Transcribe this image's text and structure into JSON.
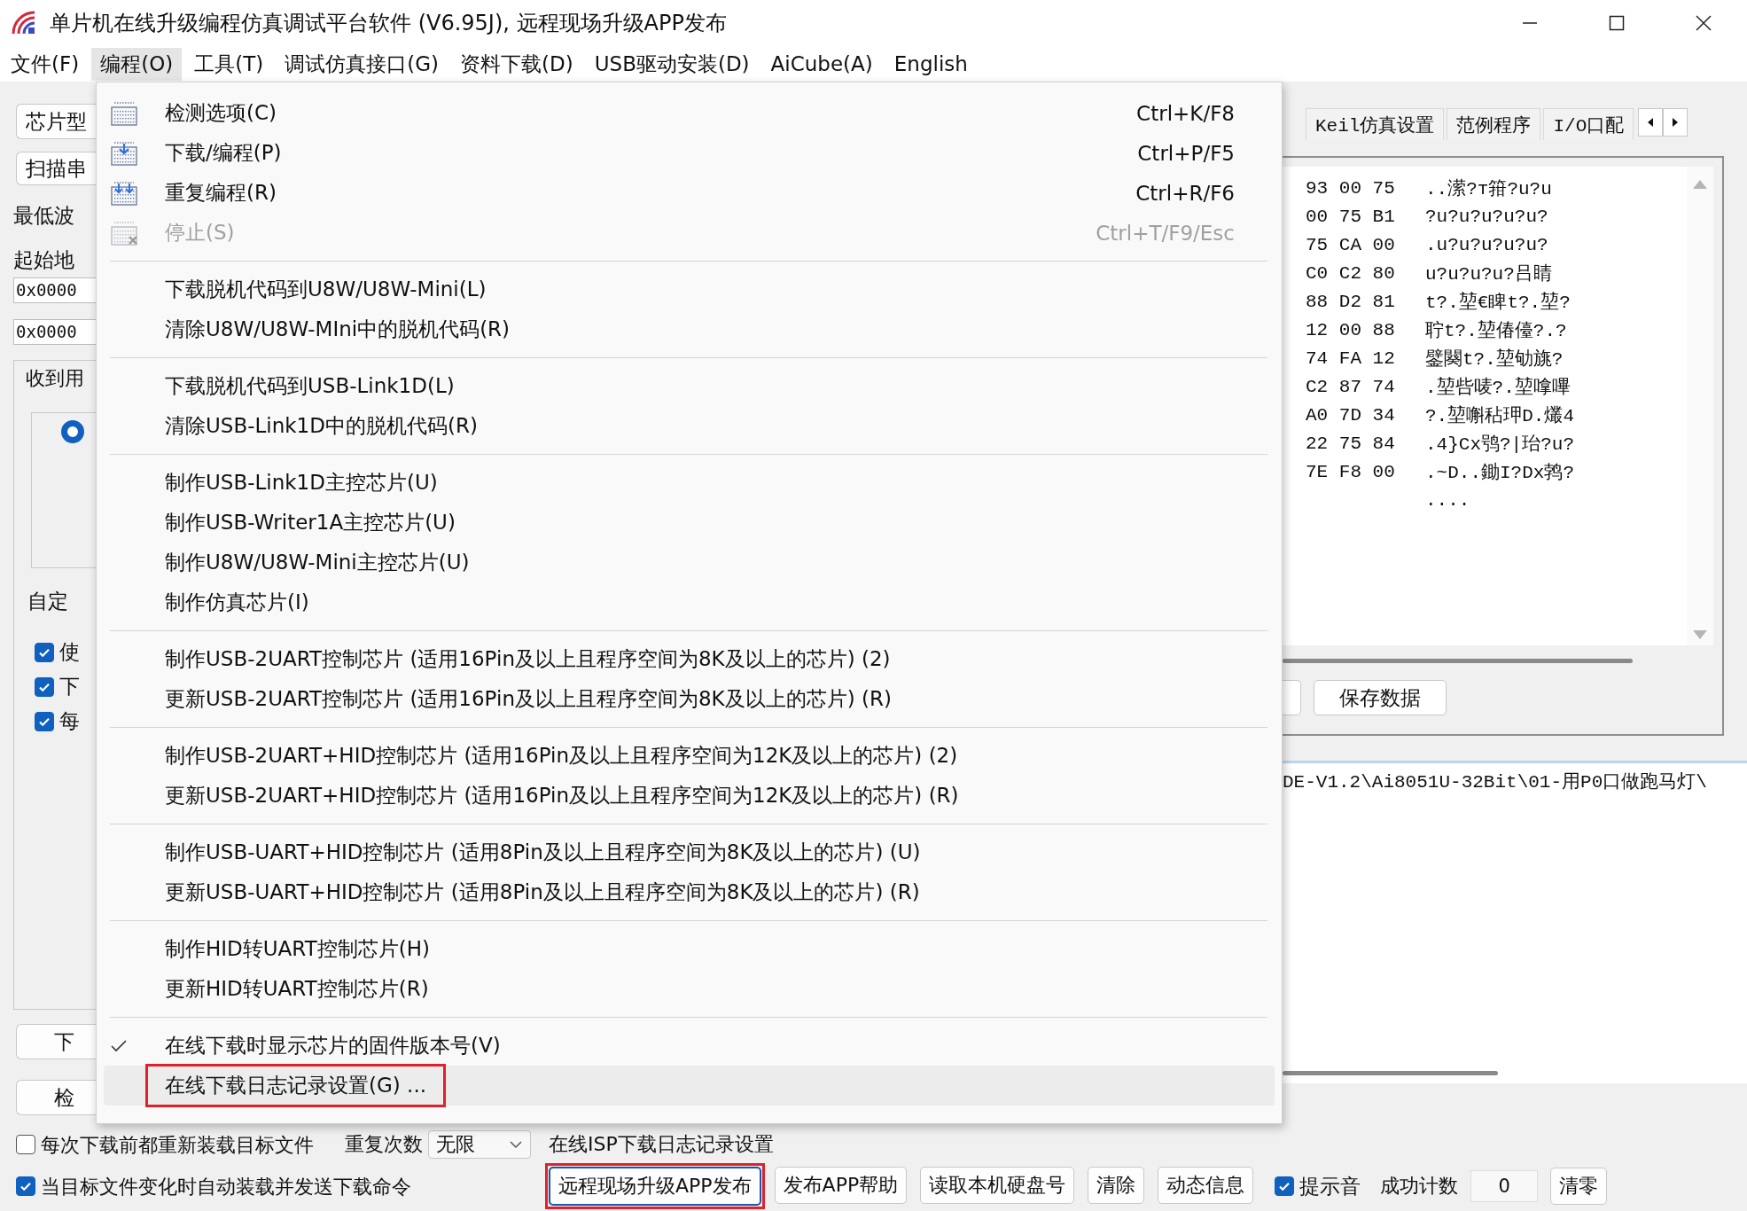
{
  "window": {
    "title": "单片机在线升级编程仿真调试平台软件 (V6.95J), 远程现场升级APP发布"
  },
  "menubar": [
    {
      "label": "文件(F)",
      "selected": false
    },
    {
      "label": "编程(O)",
      "selected": true
    },
    {
      "label": "工具(T)",
      "selected": false
    },
    {
      "label": "调试仿真接口(G)",
      "selected": false
    },
    {
      "label": "资料下载(D)",
      "selected": false
    },
    {
      "label": "USB驱动安装(D)",
      "selected": false
    },
    {
      "label": "AiCube(A)",
      "selected": false
    },
    {
      "label": "English",
      "selected": false
    }
  ],
  "left_panel": {
    "buttons_top": [
      "芯片型",
      "扫描串"
    ],
    "labels": [
      "最低波",
      "起始地"
    ],
    "fields": [
      "0x0000",
      "0x0000"
    ],
    "group_label": "收到用",
    "radio": {
      "selected": true
    },
    "custom_label": "自定",
    "checkboxes": [
      {
        "label": "使",
        "checked": true
      },
      {
        "label": "下",
        "checked": true
      },
      {
        "label": "每",
        "checked": true
      }
    ],
    "buttons_bottom": [
      "下",
      "检"
    ]
  },
  "right_panel": {
    "tabs": [
      {
        "label": "Keil仿真设置"
      },
      {
        "label": "范例程序"
      },
      {
        "label": "I/O口配"
      }
    ],
    "hex_rows": [
      {
        "hex": "93 00 75",
        "ascii": "..潆?т箝?u?u"
      },
      {
        "hex": "00 75 B1",
        "ascii": "?u?u?u?u?u?"
      },
      {
        "hex": "75 CA 00",
        "ascii": ".u?u?u?u?u?"
      },
      {
        "hex": "C0 C2 80",
        "ascii": "u?u?u?u?吕睛"
      },
      {
        "hex": "88 D2 81",
        "ascii": "t?.堃€睥t?.堃?"
      },
      {
        "hex": "12 00 88",
        "ascii": "聍t?.堃偆儓?.?"
      },
      {
        "hex": "74 FA 12",
        "ascii": "鐾闋t?.堃劬旐?"
      },
      {
        "hex": "C2 87 74",
        "ascii": ".堃呰唛?.堃嗱嗶"
      },
      {
        "hex": "A0 7D 34",
        "ascii": "?.堃嘝秥玾D.爜4"
      },
      {
        "hex": "22 75 84",
        "ascii": ".4}Cx鸮?|珆?u?"
      },
      {
        "hex": "7E F8 00",
        "ascii": ".~D..鋤I?Dx鹁?"
      },
      {
        "ascii": "...."
      }
    ],
    "buttons": [
      "保存数据"
    ],
    "log_lines": [
      "DE-V1.2\\Ai8051U-32Bit\\01-用P0口做跑马灯\\"
    ]
  },
  "menu": {
    "groups": [
      {
        "items": [
          {
            "label": "检测选项(C)",
            "shortcut": "Ctrl+K/F8",
            "kind": "check",
            "disabled": false,
            "checked": false,
            "hovered": false,
            "annotated": false
          },
          {
            "label": "下载/编程(P)",
            "shortcut": "Ctrl+P/F5",
            "kind": "download",
            "disabled": false,
            "checked": false,
            "hovered": false,
            "annotated": false
          },
          {
            "label": "重复编程(R)",
            "shortcut": "Ctrl+R/F6",
            "kind": "repeat",
            "disabled": false,
            "checked": false,
            "hovered": false,
            "annotated": false
          },
          {
            "label": "停止(S)",
            "shortcut": "Ctrl+T/F9/Esc",
            "kind": "stop",
            "disabled": true,
            "checked": false,
            "hovered": false,
            "annotated": false
          }
        ]
      },
      {
        "items": [
          {
            "label": "下载脱机代码到U8W/U8W-Mini(L)",
            "disabled": false,
            "checked": false,
            "hovered": false,
            "annotated": false
          },
          {
            "label": "清除U8W/U8W-MIni中的脱机代码(R)",
            "disabled": false,
            "checked": false,
            "hovered": false,
            "annotated": false
          }
        ]
      },
      {
        "items": [
          {
            "label": "下载脱机代码到USB-Link1D(L)",
            "disabled": false,
            "checked": false,
            "hovered": false,
            "annotated": false
          },
          {
            "label": "清除USB-Link1D中的脱机代码(R)",
            "disabled": false,
            "checked": false,
            "hovered": false,
            "annotated": false
          }
        ]
      },
      {
        "items": [
          {
            "label": "制作USB-Link1D主控芯片(U)",
            "disabled": false,
            "checked": false,
            "hovered": false,
            "annotated": false
          },
          {
            "label": "制作USB-Writer1A主控芯片(U)",
            "disabled": false,
            "checked": false,
            "hovered": false,
            "annotated": false
          },
          {
            "label": "制作U8W/U8W-Mini主控芯片(U)",
            "disabled": false,
            "checked": false,
            "hovered": false,
            "annotated": false
          },
          {
            "label": "制作仿真芯片(I)",
            "disabled": false,
            "checked": false,
            "hovered": false,
            "annotated": false
          }
        ]
      },
      {
        "items": [
          {
            "label": "制作USB-2UART控制芯片 (适用16Pin及以上且程序空间为8K及以上的芯片) (2)",
            "disabled": false,
            "checked": false,
            "hovered": false,
            "annotated": false
          },
          {
            "label": "更新USB-2UART控制芯片 (适用16Pin及以上且程序空间为8K及以上的芯片) (R)",
            "disabled": false,
            "checked": false,
            "hovered": false,
            "annotated": false
          }
        ]
      },
      {
        "items": [
          {
            "label": "制作USB-2UART+HID控制芯片 (适用16Pin及以上且程序空间为12K及以上的芯片) (2)",
            "disabled": false,
            "checked": false,
            "hovered": false,
            "annotated": false
          },
          {
            "label": "更新USB-2UART+HID控制芯片 (适用16Pin及以上且程序空间为12K及以上的芯片) (R)",
            "disabled": false,
            "checked": false,
            "hovered": false,
            "annotated": false
          }
        ]
      },
      {
        "items": [
          {
            "label": "制作USB-UART+HID控制芯片 (适用8Pin及以上且程序空间为8K及以上的芯片) (U)",
            "disabled": false,
            "checked": false,
            "hovered": false,
            "annotated": false
          },
          {
            "label": "更新USB-UART+HID控制芯片 (适用8Pin及以上且程序空间为8K及以上的芯片) (R)",
            "disabled": false,
            "checked": false,
            "hovered": false,
            "annotated": false
          }
        ]
      },
      {
        "items": [
          {
            "label": "制作HID转UART控制芯片(H)",
            "disabled": false,
            "checked": false,
            "hovered": false,
            "annotated": false
          },
          {
            "label": "更新HID转UART控制芯片(R)",
            "disabled": false,
            "checked": false,
            "hovered": false,
            "annotated": false
          }
        ]
      },
      {
        "items": [
          {
            "label": "在线下载时显示芯片的固件版本号(V)",
            "disabled": false,
            "checked": true,
            "hovered": false,
            "annotated": false
          },
          {
            "label": "在线下载日志记录设置(G) ...",
            "disabled": false,
            "checked": false,
            "hovered": true,
            "annotated": true
          }
        ]
      }
    ]
  },
  "bottom": {
    "reload_checkbox": {
      "label": "每次下载前都重新装载目标文件",
      "checked": false
    },
    "repeat_label": "重复次数",
    "repeat_select": {
      "value": "无限"
    },
    "status_text": "在线ISP下载日志记录设置",
    "auto_checkbox": {
      "label": "当目标文件变化时自动装载并发送下载命令",
      "checked": true
    },
    "buttons": [
      {
        "label": "远程现场升级APP发布",
        "annotated": true
      },
      {
        "label": "发布APP帮助",
        "annotated": false
      },
      {
        "label": "读取本机硬盘号",
        "annotated": false
      },
      {
        "label": "清除",
        "annotated": false
      },
      {
        "label": "动态信息",
        "annotated": false
      }
    ],
    "sound_checkbox": {
      "label": "提示音",
      "checked": true
    },
    "count_label": "成功计数",
    "count_value": "0",
    "reset_button": "清零"
  }
}
